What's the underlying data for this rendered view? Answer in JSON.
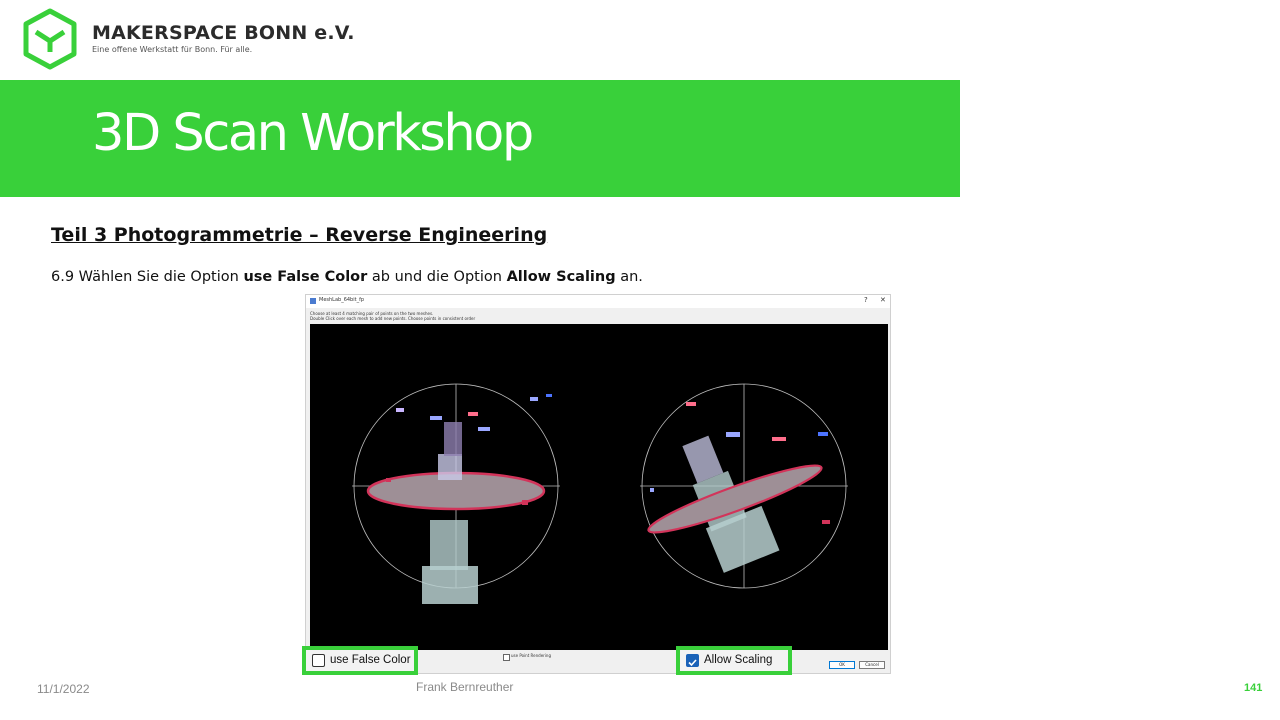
{
  "header": {
    "brand_name": "MAKERSPACE BONN e.V.",
    "brand_tagline": "Eine offene Werkstatt für Bonn. Für alle.",
    "logo_icon": "hexagon-cube-logo-icon",
    "accent_color": "#39d03a"
  },
  "banner": {
    "title": "3D Scan Workshop"
  },
  "content": {
    "subtitle": "Teil 3  Photogrammetrie  – Reverse Engineering",
    "instruction": {
      "prefix": "6.9 Wählen Sie die Option ",
      "option1": "use False Color",
      "middle": " ab und die Option ",
      "option2": "Allow Scaling",
      "suffix": " an."
    }
  },
  "dialog": {
    "title": "MeshLab_64bit_fp",
    "help_glyph": "?",
    "close_glyph": "✕",
    "instruction_line1": "Choose at least 4 matching pair of points on the two meshes.",
    "instruction_line2": "Double Click over each mesh to add new points. Choose points in consistent order",
    "point_rendering_label": "use Point Rendering",
    "ok_label": "OK",
    "cancel_label": "Cancel"
  },
  "highlights": {
    "false_color": {
      "label": "use False Color",
      "checked": false
    },
    "allow_scaling": {
      "label": "Allow Scaling",
      "checked": true
    }
  },
  "footer": {
    "date": "11/1/2022",
    "author": "Frank Bernreuther",
    "page_number": "141"
  }
}
